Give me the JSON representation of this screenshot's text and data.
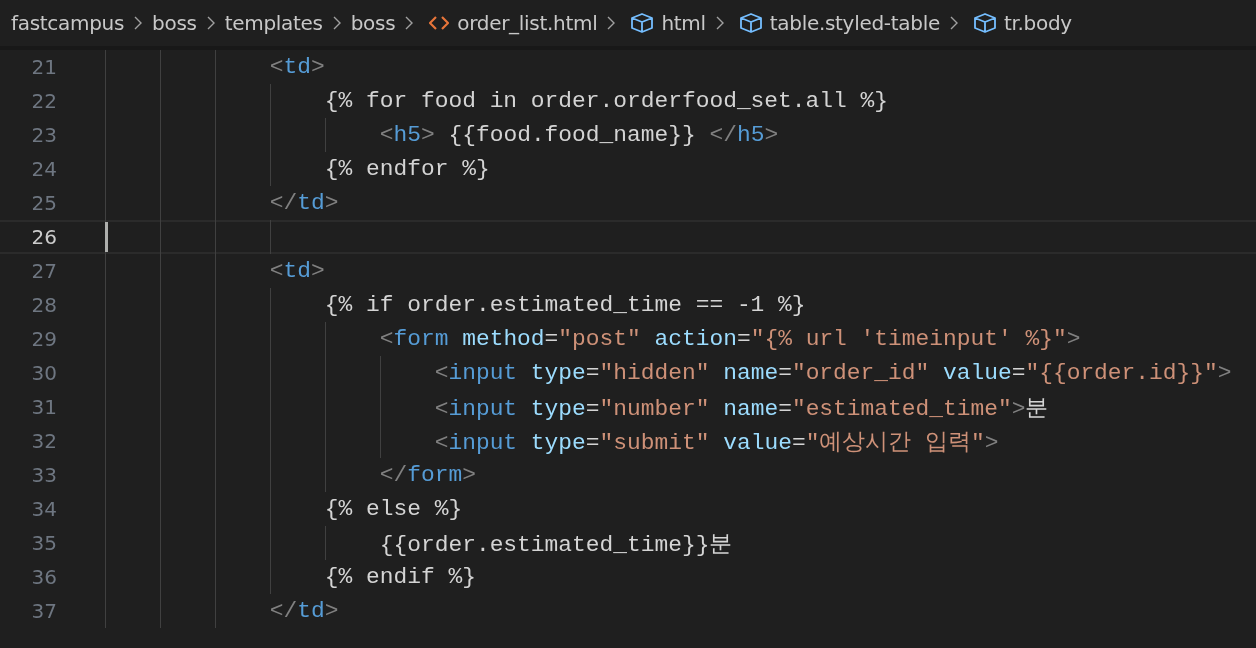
{
  "breadcrumbs": [
    {
      "kind": "folder",
      "label": "fastcampus"
    },
    {
      "kind": "folder",
      "label": "boss"
    },
    {
      "kind": "folder",
      "label": "templates"
    },
    {
      "kind": "folder",
      "label": "boss"
    },
    {
      "kind": "file",
      "label": "order_list.html"
    },
    {
      "kind": "symbol",
      "label": "html"
    },
    {
      "kind": "symbol",
      "label": "table.styled-table"
    },
    {
      "kind": "symbol",
      "label": "tr.body"
    }
  ],
  "lines": [
    {
      "number": "21",
      "current": false,
      "tokens": [
        {
          "kind": "p",
          "text": "            <"
        },
        {
          "kind": "tag",
          "text": "td"
        },
        {
          "kind": "p",
          "text": ">"
        }
      ]
    },
    {
      "number": "22",
      "current": false,
      "tokens": [
        {
          "kind": "text",
          "text": "                {% for food in order.orderfood_set.all %}"
        }
      ]
    },
    {
      "number": "23",
      "current": false,
      "tokens": [
        {
          "kind": "p",
          "text": "                    <"
        },
        {
          "kind": "tag",
          "text": "h5"
        },
        {
          "kind": "p",
          "text": ">"
        },
        {
          "kind": "text",
          "text": " {{food.food_name}} "
        },
        {
          "kind": "p",
          "text": "</"
        },
        {
          "kind": "tag",
          "text": "h5"
        },
        {
          "kind": "p",
          "text": ">"
        }
      ]
    },
    {
      "number": "24",
      "current": false,
      "tokens": [
        {
          "kind": "text",
          "text": "                {% endfor %}"
        }
      ]
    },
    {
      "number": "25",
      "current": false,
      "tokens": [
        {
          "kind": "p",
          "text": "            </"
        },
        {
          "kind": "tag",
          "text": "td"
        },
        {
          "kind": "p",
          "text": ">"
        }
      ]
    },
    {
      "number": "26",
      "current": true
    },
    {
      "number": "27",
      "current": false,
      "tokens": [
        {
          "kind": "p",
          "text": "            <"
        },
        {
          "kind": "tag",
          "text": "td"
        },
        {
          "kind": "p",
          "text": ">"
        }
      ]
    },
    {
      "number": "28",
      "current": false,
      "tokens": [
        {
          "kind": "text",
          "text": "                {% if order.estimated_time == -1 %}"
        }
      ]
    },
    {
      "number": "29",
      "current": false,
      "tokens": [
        {
          "kind": "p",
          "text": "                    <"
        },
        {
          "kind": "tag",
          "text": "form"
        },
        {
          "kind": "attr",
          "text": " method"
        },
        {
          "kind": "text",
          "text": "="
        },
        {
          "kind": "str",
          "text": "\"post\""
        },
        {
          "kind": "attr",
          "text": " action"
        },
        {
          "kind": "text",
          "text": "="
        },
        {
          "kind": "str",
          "text": "\"{% url 'timeinput' %}\""
        },
        {
          "kind": "p",
          "text": ">"
        }
      ]
    },
    {
      "number": "30",
      "current": false,
      "tokens": [
        {
          "kind": "p",
          "text": "                        <"
        },
        {
          "kind": "tag",
          "text": "input"
        },
        {
          "kind": "attr",
          "text": " type"
        },
        {
          "kind": "text",
          "text": "="
        },
        {
          "kind": "str",
          "text": "\"hidden\""
        },
        {
          "kind": "attr",
          "text": " name"
        },
        {
          "kind": "text",
          "text": "="
        },
        {
          "kind": "str",
          "text": "\"order_id\""
        },
        {
          "kind": "attr",
          "text": " value"
        },
        {
          "kind": "text",
          "text": "="
        },
        {
          "kind": "str",
          "text": "\"{{order.id}}\""
        },
        {
          "kind": "p",
          "text": ">"
        }
      ]
    },
    {
      "number": "31",
      "current": false,
      "tokens": [
        {
          "kind": "p",
          "text": "                        <"
        },
        {
          "kind": "tag",
          "text": "input"
        },
        {
          "kind": "attr",
          "text": " type"
        },
        {
          "kind": "text",
          "text": "="
        },
        {
          "kind": "str",
          "text": "\"number\""
        },
        {
          "kind": "attr",
          "text": " name"
        },
        {
          "kind": "text",
          "text": "="
        },
        {
          "kind": "str",
          "text": "\"estimated_time\""
        },
        {
          "kind": "p",
          "text": ">"
        },
        {
          "kind": "text",
          "text": "분"
        }
      ]
    },
    {
      "number": "32",
      "current": false,
      "tokens": [
        {
          "kind": "p",
          "text": "                        <"
        },
        {
          "kind": "tag",
          "text": "input"
        },
        {
          "kind": "attr",
          "text": " type"
        },
        {
          "kind": "text",
          "text": "="
        },
        {
          "kind": "str",
          "text": "\"submit\""
        },
        {
          "kind": "attr",
          "text": " value"
        },
        {
          "kind": "text",
          "text": "="
        },
        {
          "kind": "str",
          "text": "\"예상시간 입력\""
        },
        {
          "kind": "p",
          "text": ">"
        }
      ]
    },
    {
      "number": "33",
      "current": false,
      "tokens": [
        {
          "kind": "p",
          "text": "                    </"
        },
        {
          "kind": "tag",
          "text": "form"
        },
        {
          "kind": "p",
          "text": ">"
        }
      ]
    },
    {
      "number": "34",
      "current": false,
      "tokens": [
        {
          "kind": "text",
          "text": "                {% else %}"
        }
      ]
    },
    {
      "number": "35",
      "current": false,
      "tokens": [
        {
          "kind": "text",
          "text": "                    {{order.estimated_time}}분"
        }
      ]
    },
    {
      "number": "36",
      "current": false,
      "tokens": [
        {
          "kind": "text",
          "text": "                {% endif %}"
        }
      ]
    },
    {
      "number": "37",
      "current": false,
      "tokens": [
        {
          "kind": "p",
          "text": "            </"
        },
        {
          "kind": "tag",
          "text": "td"
        },
        {
          "kind": "p",
          "text": ">"
        }
      ]
    }
  ]
}
